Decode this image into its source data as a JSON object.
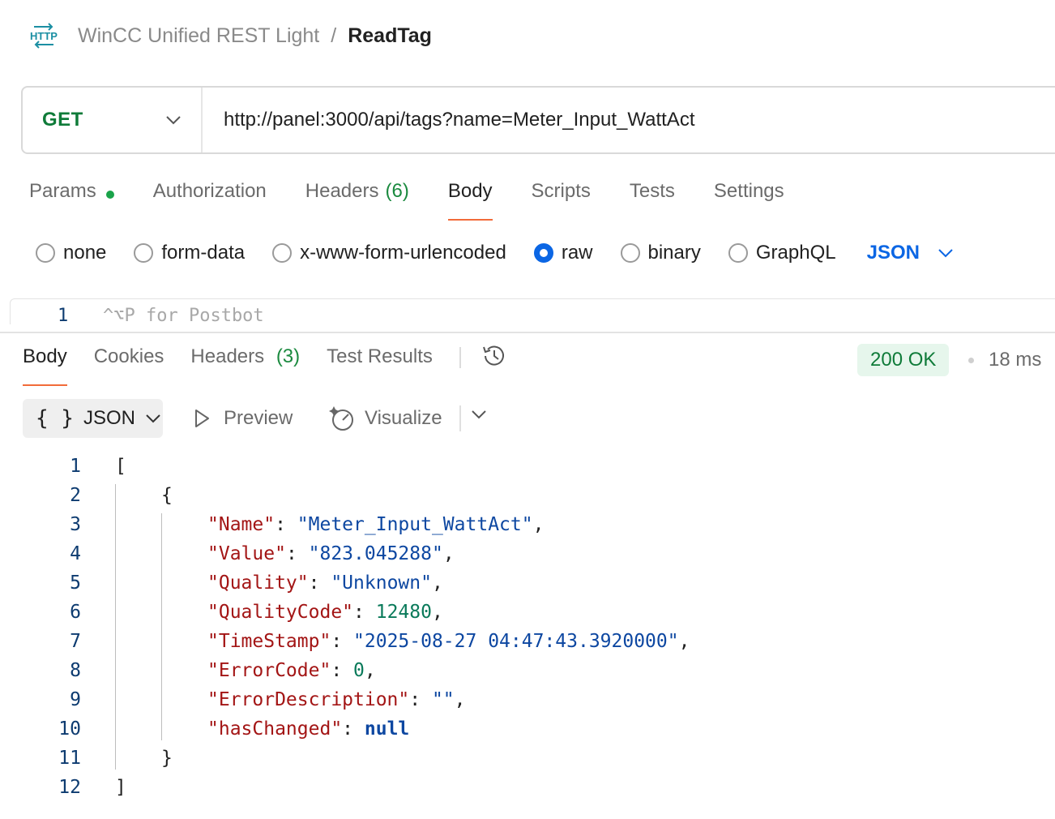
{
  "breadcrumb": {
    "icon": "http-icon",
    "parent": "WinCC Unified REST Light",
    "separator": "/",
    "current": "ReadTag"
  },
  "request": {
    "method": "GET",
    "url": "http://panel:3000/api/tags?name=Meter_Input_WattAct",
    "tabs": [
      {
        "label": "Params",
        "has_dot": true
      },
      {
        "label": "Authorization"
      },
      {
        "label": "Headers",
        "count": "(6)"
      },
      {
        "label": "Body",
        "active": true
      },
      {
        "label": "Scripts"
      },
      {
        "label": "Tests"
      },
      {
        "label": "Settings"
      }
    ],
    "body_types": [
      "none",
      "form-data",
      "x-www-form-urlencoded",
      "raw",
      "binary",
      "GraphQL"
    ],
    "selected_body_type": "raw",
    "raw_language": "JSON",
    "editor": {
      "line": "1",
      "hint": "^⌥P for Postbot"
    }
  },
  "response": {
    "tabs": [
      {
        "label": "Body",
        "active": true
      },
      {
        "label": "Cookies"
      },
      {
        "label": "Headers",
        "count": "(3)"
      },
      {
        "label": "Test Results"
      }
    ],
    "status": "200 OK",
    "time": "18 ms",
    "format": "JSON",
    "format_icon": "{ }",
    "preview_label": "Preview",
    "visualize_label": "Visualize",
    "lines": [
      {
        "n": "1",
        "indent": 0,
        "parts": [
          [
            "punct",
            "["
          ]
        ]
      },
      {
        "n": "2",
        "indent": 1,
        "parts": [
          [
            "punct",
            "{"
          ]
        ]
      },
      {
        "n": "3",
        "indent": 2,
        "parts": [
          [
            "key",
            "\"Name\""
          ],
          [
            "punct",
            ": "
          ],
          [
            "str",
            "\"Meter_Input_WattAct\""
          ],
          [
            "punct",
            ","
          ]
        ]
      },
      {
        "n": "4",
        "indent": 2,
        "parts": [
          [
            "key",
            "\"Value\""
          ],
          [
            "punct",
            ": "
          ],
          [
            "str",
            "\"823.045288\""
          ],
          [
            "punct",
            ","
          ]
        ]
      },
      {
        "n": "5",
        "indent": 2,
        "parts": [
          [
            "key",
            "\"Quality\""
          ],
          [
            "punct",
            ": "
          ],
          [
            "str",
            "\"Unknown\""
          ],
          [
            "punct",
            ","
          ]
        ]
      },
      {
        "n": "6",
        "indent": 2,
        "parts": [
          [
            "key",
            "\"QualityCode\""
          ],
          [
            "punct",
            ": "
          ],
          [
            "num",
            "12480"
          ],
          [
            "punct",
            ","
          ]
        ]
      },
      {
        "n": "7",
        "indent": 2,
        "parts": [
          [
            "key",
            "\"TimeStamp\""
          ],
          [
            "punct",
            ": "
          ],
          [
            "str",
            "\"2025-08-27 04:47:43.3920000\""
          ],
          [
            "punct",
            ","
          ]
        ]
      },
      {
        "n": "8",
        "indent": 2,
        "parts": [
          [
            "key",
            "\"ErrorCode\""
          ],
          [
            "punct",
            ": "
          ],
          [
            "num",
            "0"
          ],
          [
            "punct",
            ","
          ]
        ]
      },
      {
        "n": "9",
        "indent": 2,
        "parts": [
          [
            "key",
            "\"ErrorDescription\""
          ],
          [
            "punct",
            ": "
          ],
          [
            "str",
            "\"\""
          ],
          [
            "punct",
            ","
          ]
        ]
      },
      {
        "n": "10",
        "indent": 2,
        "parts": [
          [
            "key",
            "\"hasChanged\""
          ],
          [
            "punct",
            ": "
          ],
          [
            "kw",
            "null"
          ]
        ]
      },
      {
        "n": "11",
        "indent": 1,
        "parts": [
          [
            "punct",
            "}"
          ]
        ]
      },
      {
        "n": "12",
        "indent": 0,
        "parts": [
          [
            "punct",
            "]"
          ]
        ]
      }
    ]
  },
  "colors": {
    "accent_tab": "#f26b3a",
    "method_green": "#0f7b39",
    "link_blue": "#0b66e4",
    "status_bg": "#e6f6ec"
  }
}
